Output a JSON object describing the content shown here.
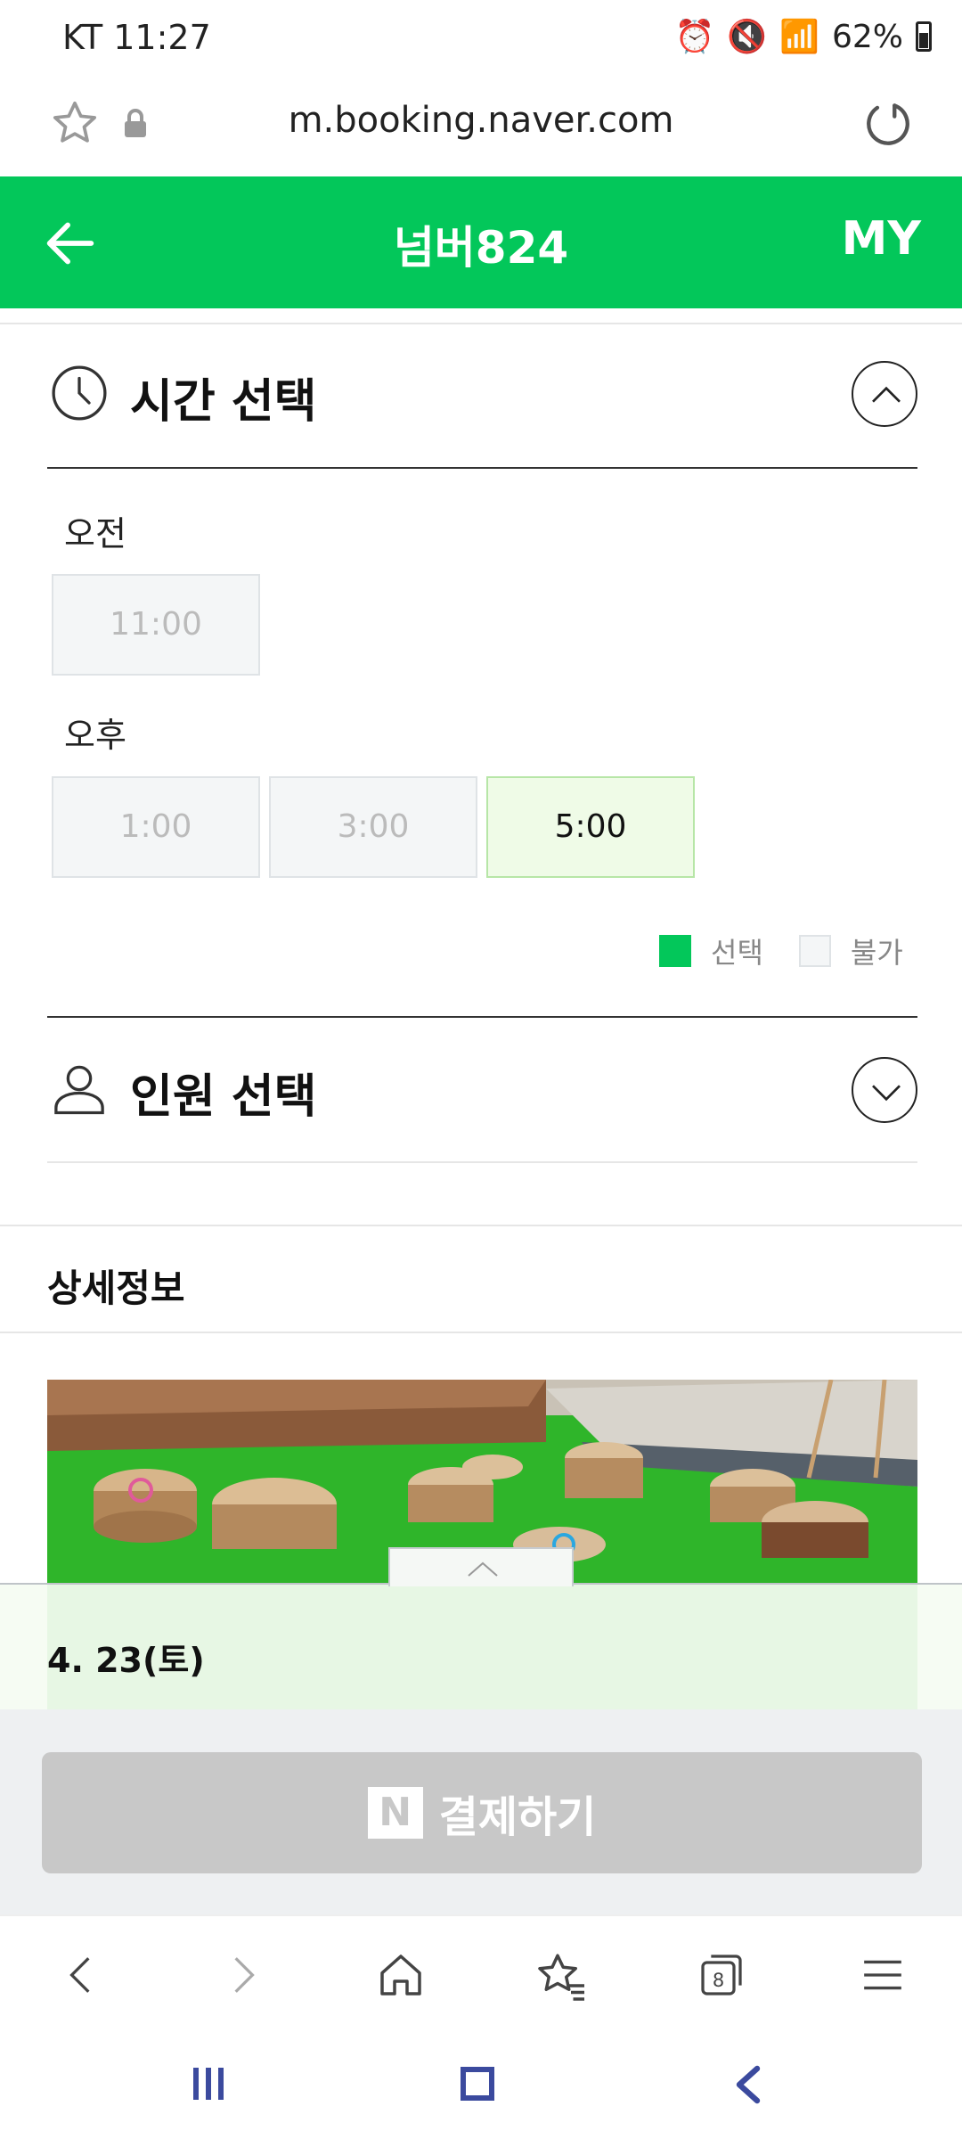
{
  "status_bar": {
    "carrier_time": "KT 11:27",
    "battery": "62%"
  },
  "browser": {
    "url": "m.booking.naver.com"
  },
  "header": {
    "title": "넘버824",
    "my_label": "MY"
  },
  "time_section": {
    "title": "시간 선택",
    "am_label": "오전",
    "am_slots": [
      "11:00"
    ],
    "pm_label": "오후",
    "pm_slots": [
      "1:00",
      "3:00",
      "5:00"
    ],
    "selected_slot": "5:00"
  },
  "legend": {
    "selected": "선택",
    "unavailable": "불가"
  },
  "people_section": {
    "title": "인원 선택"
  },
  "detail": {
    "title": "상세정보"
  },
  "date_strip": {
    "date": "4. 23(토)"
  },
  "pay_button": {
    "label": "결제하기",
    "logo": "N"
  },
  "colors": {
    "brand_green": "#03c75a",
    "selected_bg": "#effbe7",
    "disabled_bg": "#f4f6f7",
    "pay_disabled": "#c8c8c8"
  }
}
